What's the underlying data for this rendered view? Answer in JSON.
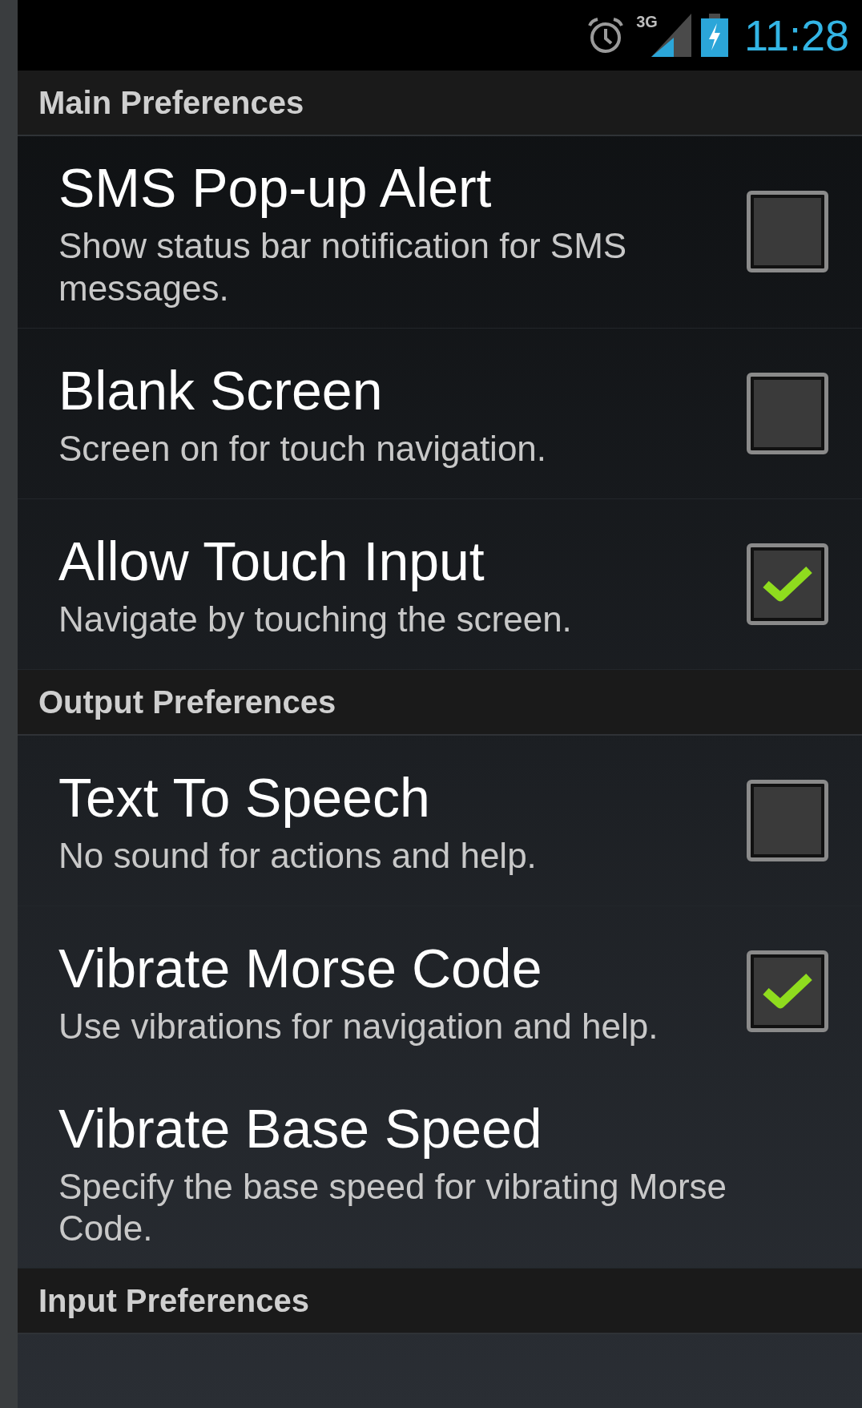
{
  "status_bar": {
    "network": "3G",
    "time": "11:28"
  },
  "sections": [
    {
      "title": "Main Preferences",
      "items": [
        {
          "title": "SMS Pop-up Alert",
          "summary": "Show status bar notification for SMS messages.",
          "kind": "checkbox",
          "checked": false
        },
        {
          "title": "Blank Screen",
          "summary": "Screen on for touch navigation.",
          "kind": "checkbox",
          "checked": false
        },
        {
          "title": "Allow Touch Input",
          "summary": "Navigate by touching the screen.",
          "kind": "checkbox",
          "checked": true
        }
      ]
    },
    {
      "title": "Output Preferences",
      "items": [
        {
          "title": "Text To Speech",
          "summary": "No sound for actions and help.",
          "kind": "checkbox",
          "checked": false
        },
        {
          "title": "Vibrate Morse Code",
          "summary": "Use vibrations for navigation and help.",
          "kind": "checkbox",
          "checked": true
        },
        {
          "title": "Vibrate Base Speed",
          "summary": "Specify the base speed for vibrating Morse Code.",
          "kind": "plain"
        }
      ]
    },
    {
      "title": "Input Preferences"
    }
  ]
}
